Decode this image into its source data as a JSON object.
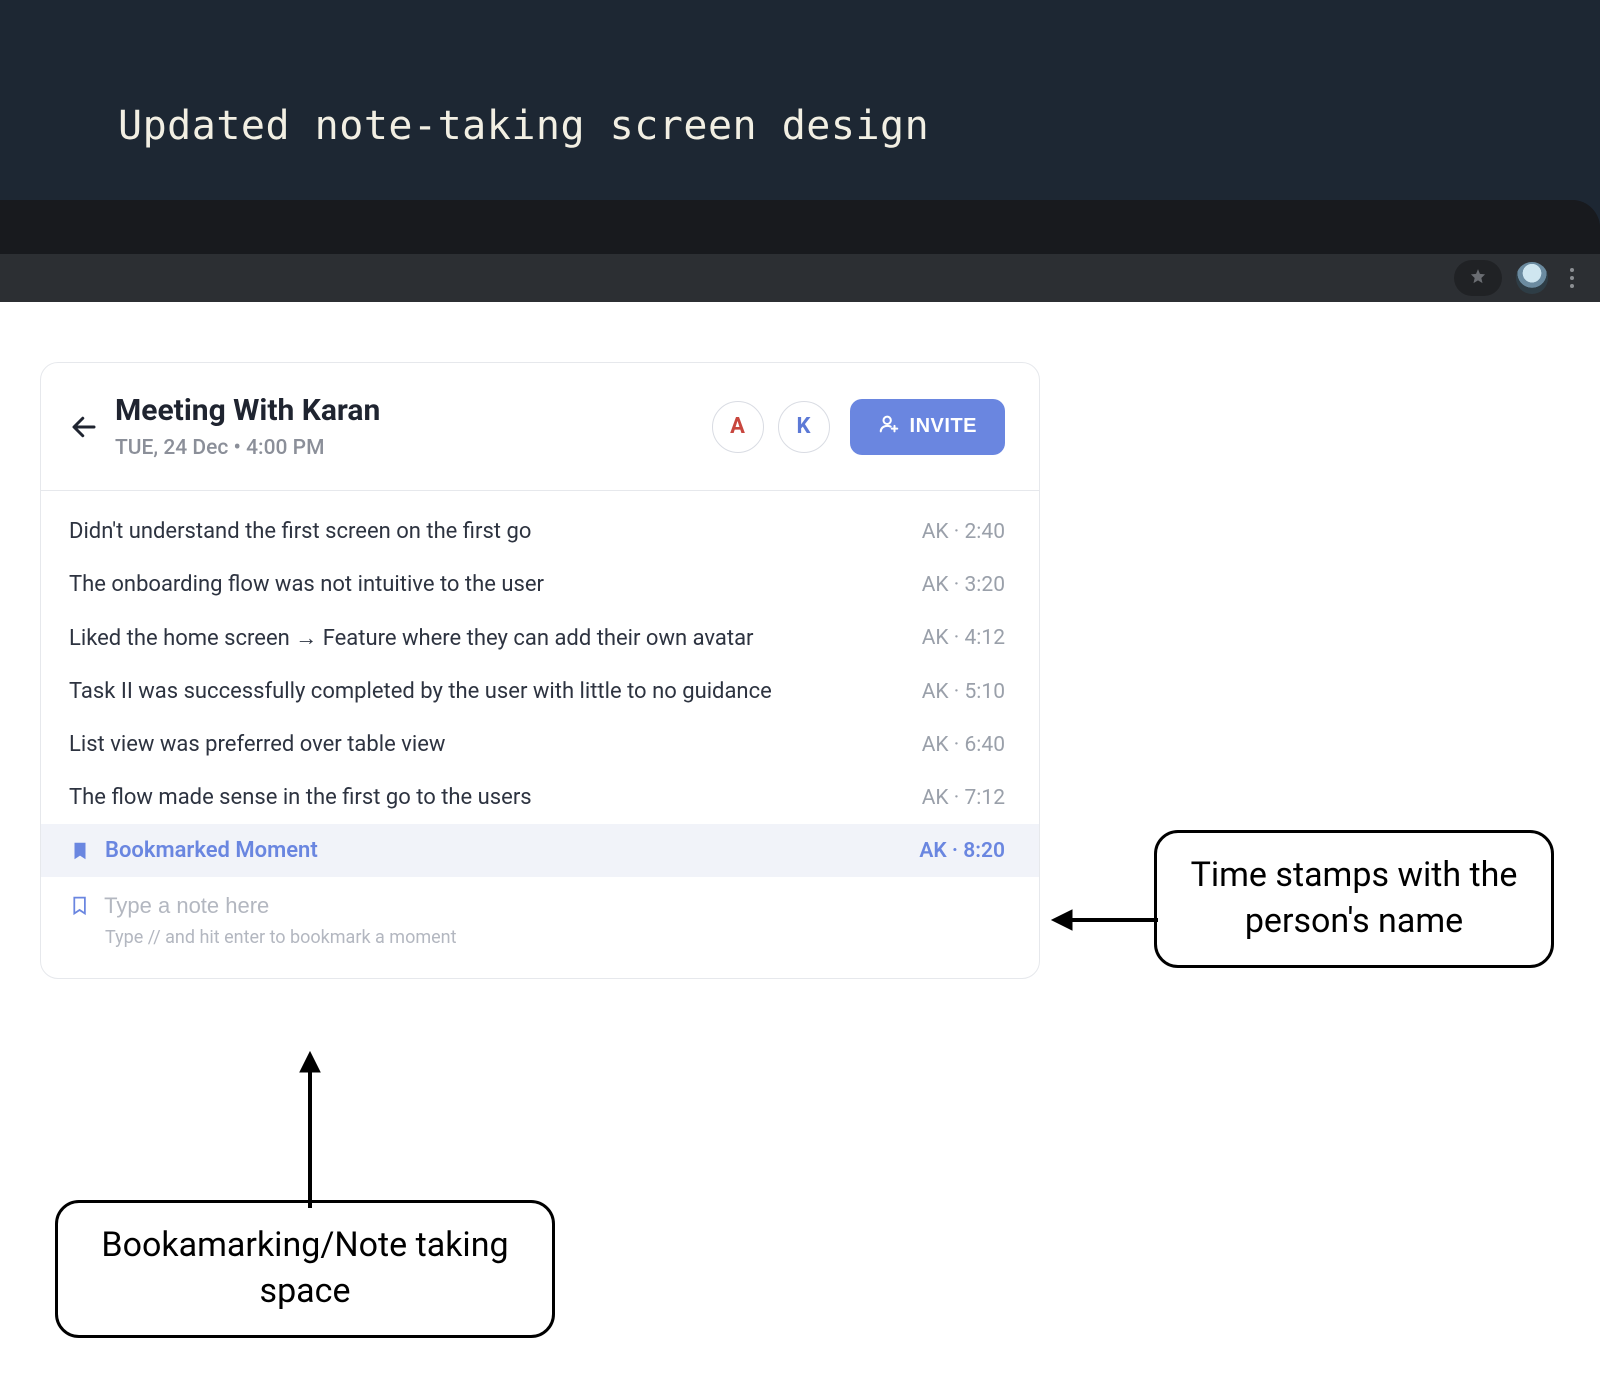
{
  "slide": {
    "title": "Updated note-taking screen design"
  },
  "header": {
    "title": "Meeting With Karan",
    "subtitle": "TUE, 24 Dec • 4:00 PM",
    "attendees": [
      {
        "initial": "A",
        "colorClass": "red"
      },
      {
        "initial": "K",
        "colorClass": "blue"
      }
    ],
    "invite_label": "INVITE"
  },
  "notes": [
    {
      "text": "Didn't understand the first screen on the first go",
      "author": "AK",
      "time": "2:40"
    },
    {
      "text": "The onboarding flow was not intuitive to the user",
      "author": "AK",
      "time": "3:20"
    },
    {
      "text": "Liked the home screen → Feature where they can add their own avatar",
      "author": "AK",
      "time": "4:12"
    },
    {
      "text": "Task II was successfully completed by the user with little to no guidance",
      "author": "AK",
      "time": "5:10"
    },
    {
      "text": "List view was preferred over table view",
      "author": "AK",
      "time": "6:40"
    },
    {
      "text": "The flow made sense in the first go to the users",
      "author": "AK",
      "time": "7:12"
    }
  ],
  "bookmark": {
    "label": "Bookmarked Moment",
    "author": "AK",
    "time": "8:20"
  },
  "input": {
    "placeholder": "Type a note here",
    "hint": "Type // and hit enter to bookmark a moment"
  },
  "annotations": {
    "timestamps": "Time stamps with the person's name",
    "notespace": "Bookamarking/Note taking space"
  }
}
